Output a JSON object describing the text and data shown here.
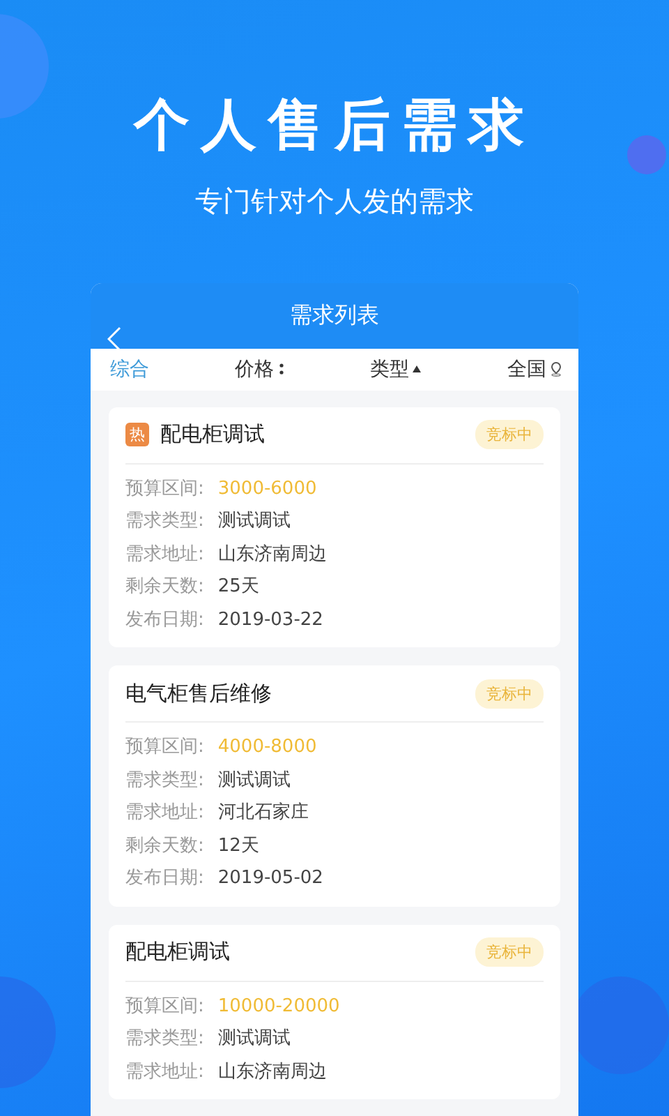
{
  "hero": {
    "title": "个人售后需求",
    "subtitle": "专门针对个人发的需求"
  },
  "nav_bar": {
    "title": "需求列表"
  },
  "filters": [
    {
      "label": "综合",
      "kind": "plain",
      "selected": true
    },
    {
      "label": "价格",
      "kind": "sort",
      "selected": false
    },
    {
      "label": "类型",
      "kind": "triangle",
      "selected": false
    },
    {
      "label": "全国",
      "kind": "location",
      "selected": false
    }
  ],
  "demands": [
    {
      "tag": "热",
      "title": "配电柜调试",
      "status": "竞标中",
      "fields": [
        {
          "label": "预算区间:",
          "value": "3000-6000",
          "kind": "budget"
        },
        {
          "label": "需求类型:",
          "value": "测试调试",
          "kind": "plain"
        },
        {
          "label": "需求地址:",
          "value": "山东济南周边",
          "kind": "plain"
        },
        {
          "label": "剩余天数:",
          "value": "25天",
          "kind": "plain"
        },
        {
          "label": "发布日期:",
          "value": "2019-03-22",
          "kind": "plain"
        }
      ]
    },
    {
      "title": "电气柜售后维修",
      "status": "竞标中",
      "fields": [
        {
          "label": "预算区间:",
          "value": "4000-8000",
          "kind": "budget"
        },
        {
          "label": "需求类型:",
          "value": "测试调试",
          "kind": "plain"
        },
        {
          "label": "需求地址:",
          "value": "河北石家庄",
          "kind": "plain"
        },
        {
          "label": "剩余天数:",
          "value": "12天",
          "kind": "plain"
        },
        {
          "label": "发布日期:",
          "value": "2019-05-02",
          "kind": "plain"
        }
      ]
    },
    {
      "title": "配电柜调试",
      "status": "竞标中",
      "fields": [
        {
          "label": "预算区间:",
          "value": "10000-20000",
          "kind": "budget"
        },
        {
          "label": "需求类型:",
          "value": "测试调试",
          "kind": "plain"
        },
        {
          "label": "需求地址:",
          "value": "山东济南周边",
          "kind": "plain"
        }
      ]
    }
  ]
}
